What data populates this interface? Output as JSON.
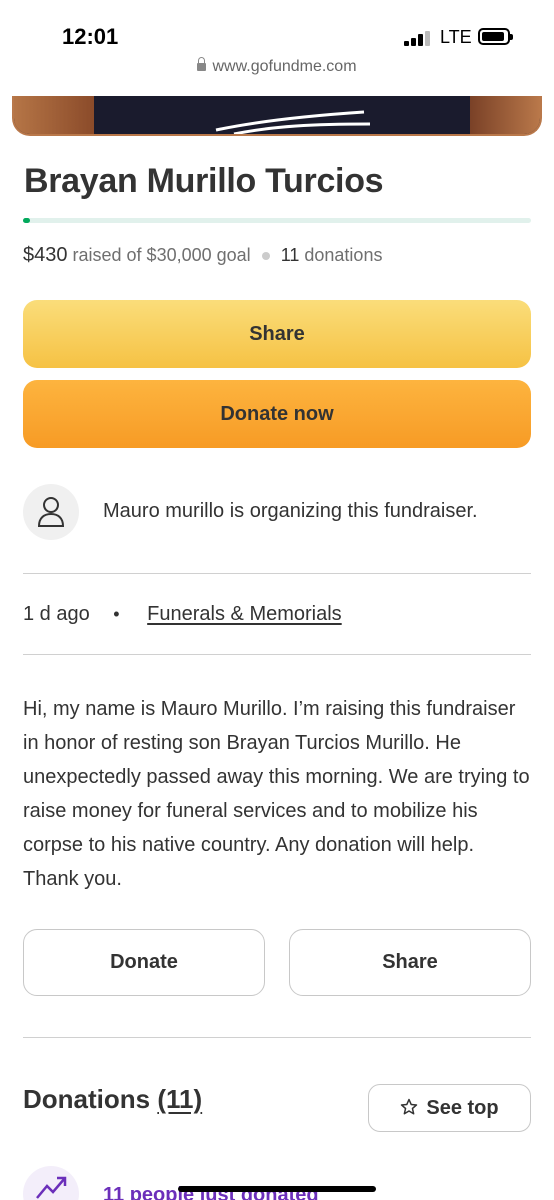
{
  "status_bar": {
    "time": "12:01",
    "network": "LTE"
  },
  "browser": {
    "url": "www.gofundme.com"
  },
  "campaign": {
    "title": "Brayan Murillo Turcios",
    "progress_fraction": 0.014,
    "raised": "$430",
    "goal_text": "raised of $30,000 goal",
    "donations_count": "11",
    "donations_label": "donations"
  },
  "actions": {
    "share_label": "Share",
    "donate_now_label": "Donate now"
  },
  "organizer": {
    "text": "Mauro murillo is organizing this fundraiser."
  },
  "meta": {
    "age": "1 d ago",
    "separator": "•",
    "category": "Funerals & Memorials"
  },
  "story": "Hi, my name is Mauro Murillo. I’m raising this fundraiser in honor of resting son Brayan Turcios Murillo. He unexpectedly passed away this morning. We are trying to raise money for funeral services and to mobilize his corpse to his native country. Any donation will help. Thank you.",
  "secondary_actions": {
    "donate_label": "Donate",
    "share_label": "Share"
  },
  "donations_section": {
    "heading": "Donations",
    "count": "(11)",
    "see_top_label": "See top",
    "recent_text": "11 people just donated"
  },
  "colors": {
    "progress_fill": "#02a95c",
    "progress_track": "#e1f1ec",
    "share_button": "#f6c244",
    "donate_button": "#f79b25",
    "recent_link": "#6b2fba"
  },
  "icons": [
    "lock-icon",
    "user-icon",
    "star-icon",
    "trending-up-icon"
  ]
}
